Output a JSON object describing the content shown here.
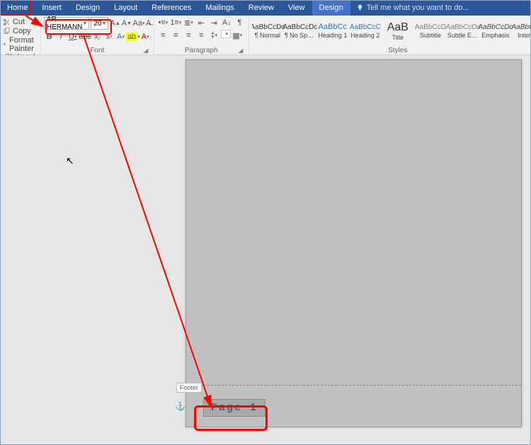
{
  "tabs": {
    "home": "Home",
    "insert": "Insert",
    "design": "Design",
    "layout": "Layout",
    "references": "References",
    "mailings": "Mailings",
    "review": "Review",
    "view": "View",
    "contextual": "Design"
  },
  "tellme": "Tell me what you want to do...",
  "clipboard": {
    "cut": "Cut",
    "copy": "Copy",
    "format_painter": "Format Painter",
    "label": "Clipboard"
  },
  "font": {
    "name": "AR HERMANN",
    "size": "20",
    "label": "Font"
  },
  "paragraph": {
    "label": "Paragraph"
  },
  "styles": {
    "label": "Styles",
    "items": [
      {
        "preview": "AaBbCcDc",
        "cls": "",
        "label": "¶ Normal"
      },
      {
        "preview": "AaBbCcDc",
        "cls": "",
        "label": "¶ No Spac..."
      },
      {
        "preview": "AaBbCc",
        "cls": "h1",
        "label": "Heading 1"
      },
      {
        "preview": "AaBbCcC",
        "cls": "h2",
        "label": "Heading 2"
      },
      {
        "preview": "AaB",
        "cls": "title",
        "label": "Title"
      },
      {
        "preview": "AaBbCcD",
        "cls": "subtitle",
        "label": "Subtitle"
      },
      {
        "preview": "AaBbCcDc",
        "cls": "em",
        "label": "Subtle Em..."
      },
      {
        "preview": "AaBbCcDc",
        "cls": "int",
        "label": "Emphasis"
      },
      {
        "preview": "AaBbCcDt",
        "cls": "int",
        "label": "Intense"
      }
    ]
  },
  "footer": {
    "tab_label": "Footer",
    "page_text": "Page 1"
  }
}
